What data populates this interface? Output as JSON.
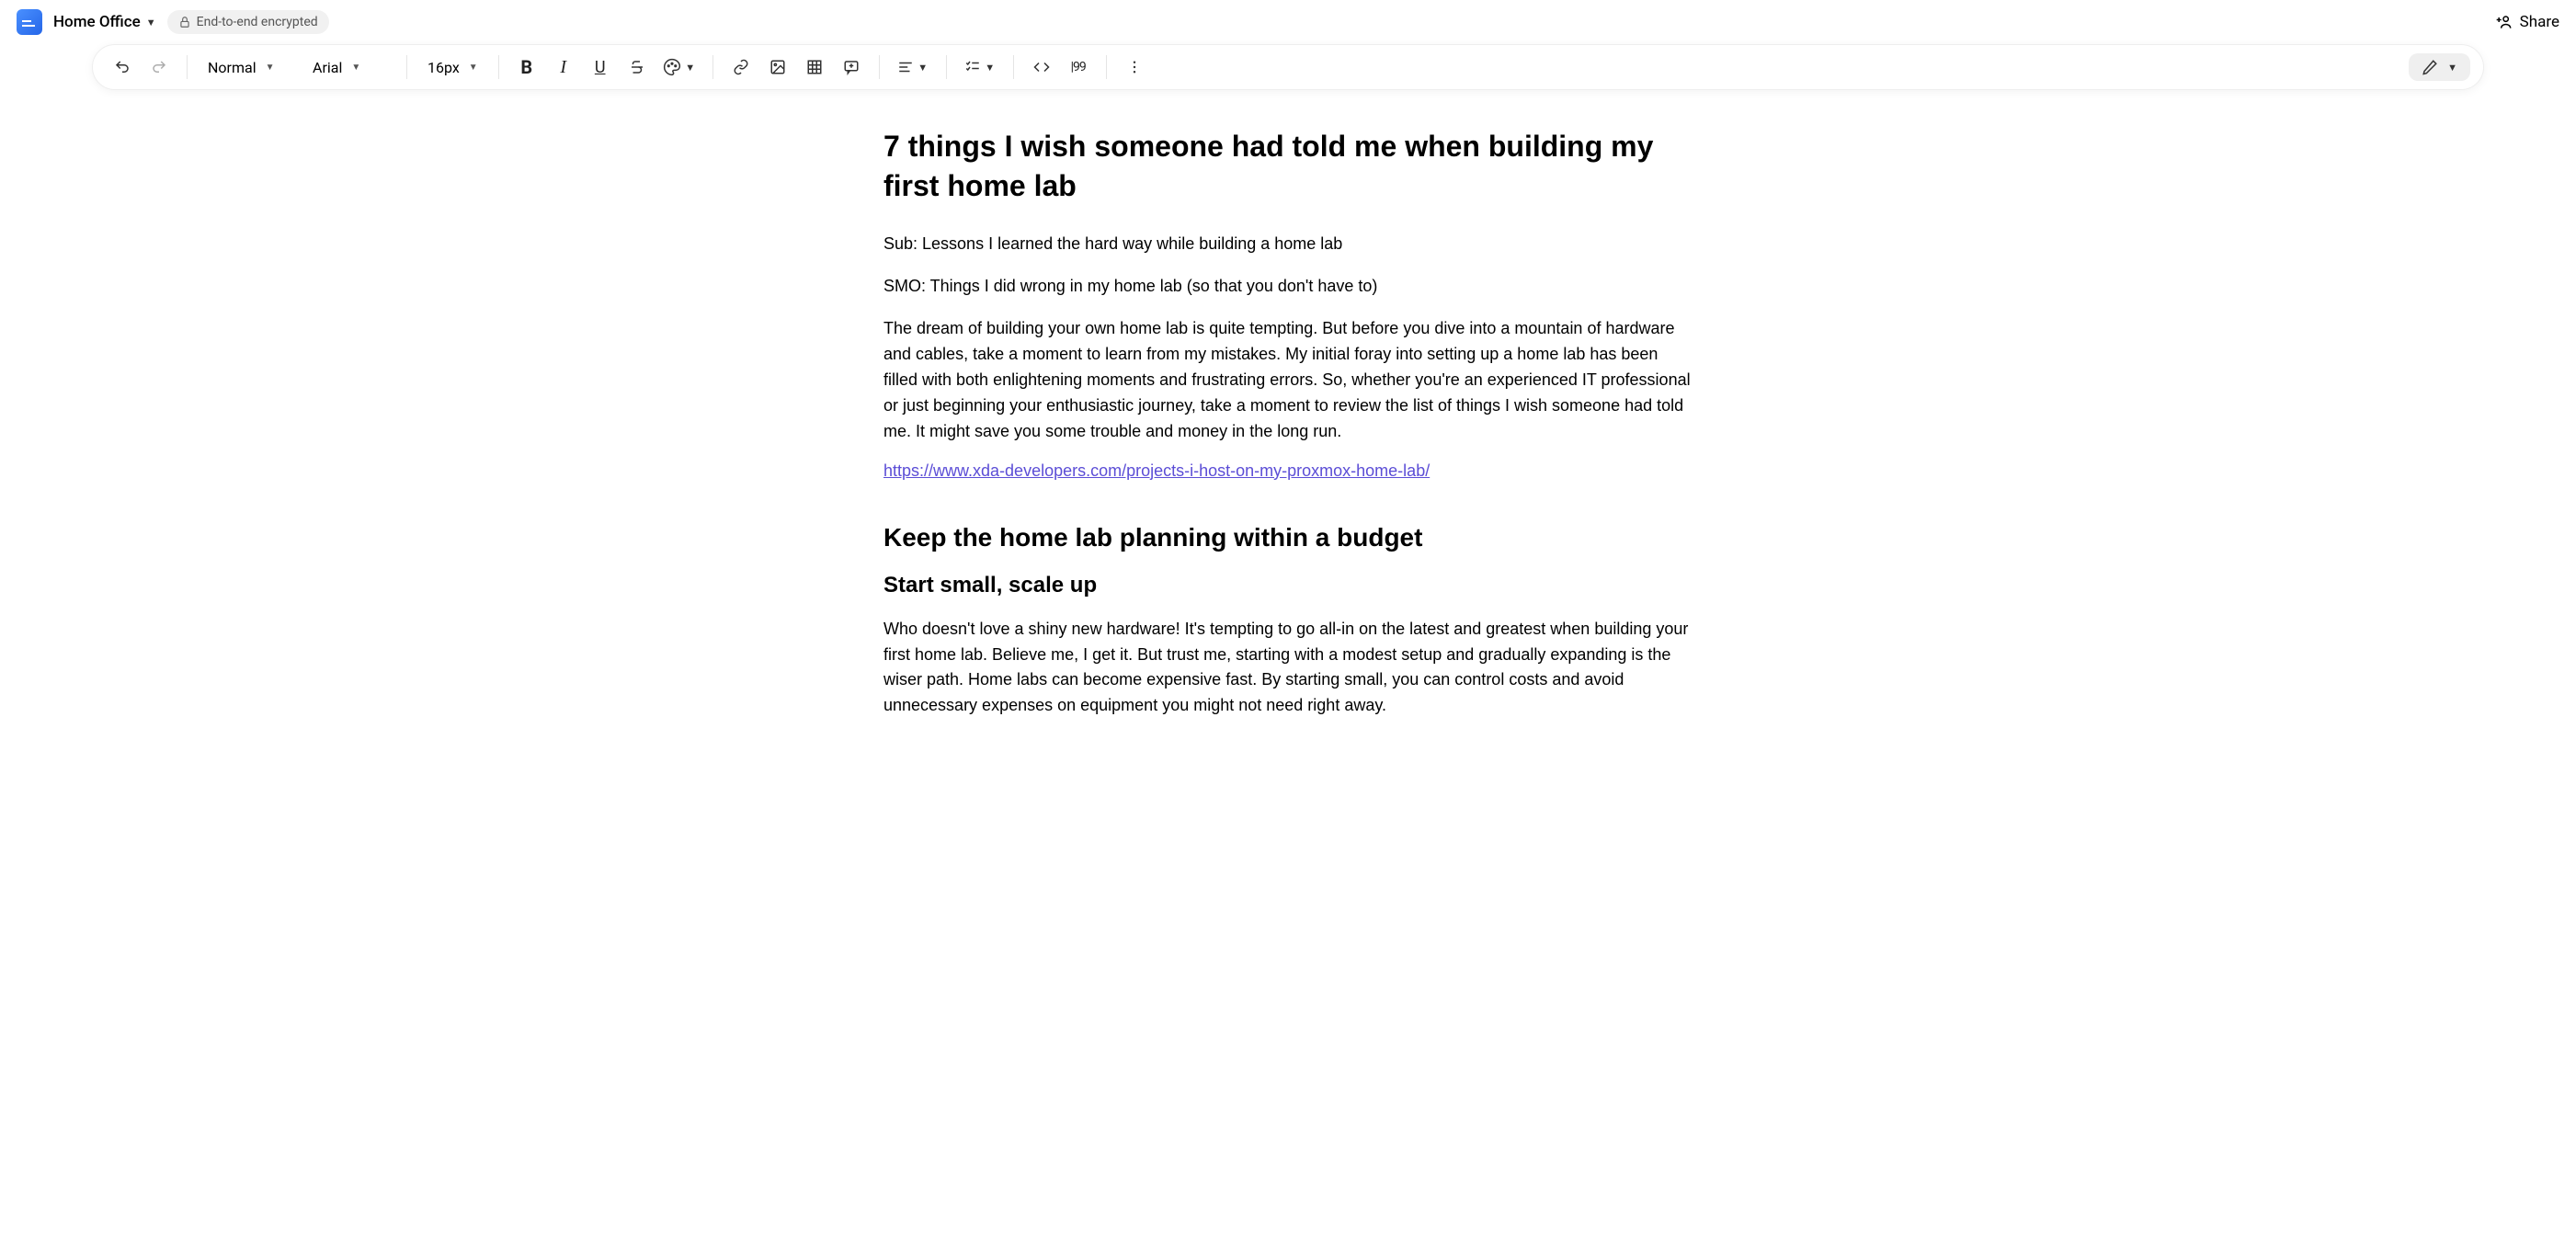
{
  "header": {
    "doc_title": "Home Office",
    "encrypted_label": "End-to-end encrypted",
    "share_label": "Share"
  },
  "toolbar": {
    "style_select": "Normal",
    "font_select": "Arial",
    "size_select": "16px",
    "word_count": "|99"
  },
  "document": {
    "title": "7 things I wish someone had told me when building my first home lab",
    "sub": "Sub: Lessons I learned the hard way while building a home lab",
    "smo": "SMO: Things I did wrong in my home lab (so that you don't have to)",
    "intro": "The dream of building your own home lab is quite tempting. But before you dive into a mountain of hardware and cables, take a moment to learn from my mistakes. My initial foray into setting up a home lab has been filled with both enlightening moments and frustrating errors. So, whether you're an experienced IT professional or just beginning your enthusiastic journey, take a moment to review the list of things I wish someone had told me. It might save you some trouble and money in the long run.",
    "link_text": "https://www.xda-developers.com/projects-i-host-on-my-proxmox-home-lab/",
    "h2_1": "Keep the home lab planning within a budget",
    "h3_1": "Start small, scale up",
    "p2": "Who doesn't love a shiny new hardware! It's tempting to go all-in on the latest and greatest when building your first home lab. Believe me, I get it. But trust me, starting with a modest setup and gradually expanding is the wiser path. Home labs can become expensive fast. By starting small, you can control costs and avoid unnecessary expenses on equipment you might not need right away."
  }
}
